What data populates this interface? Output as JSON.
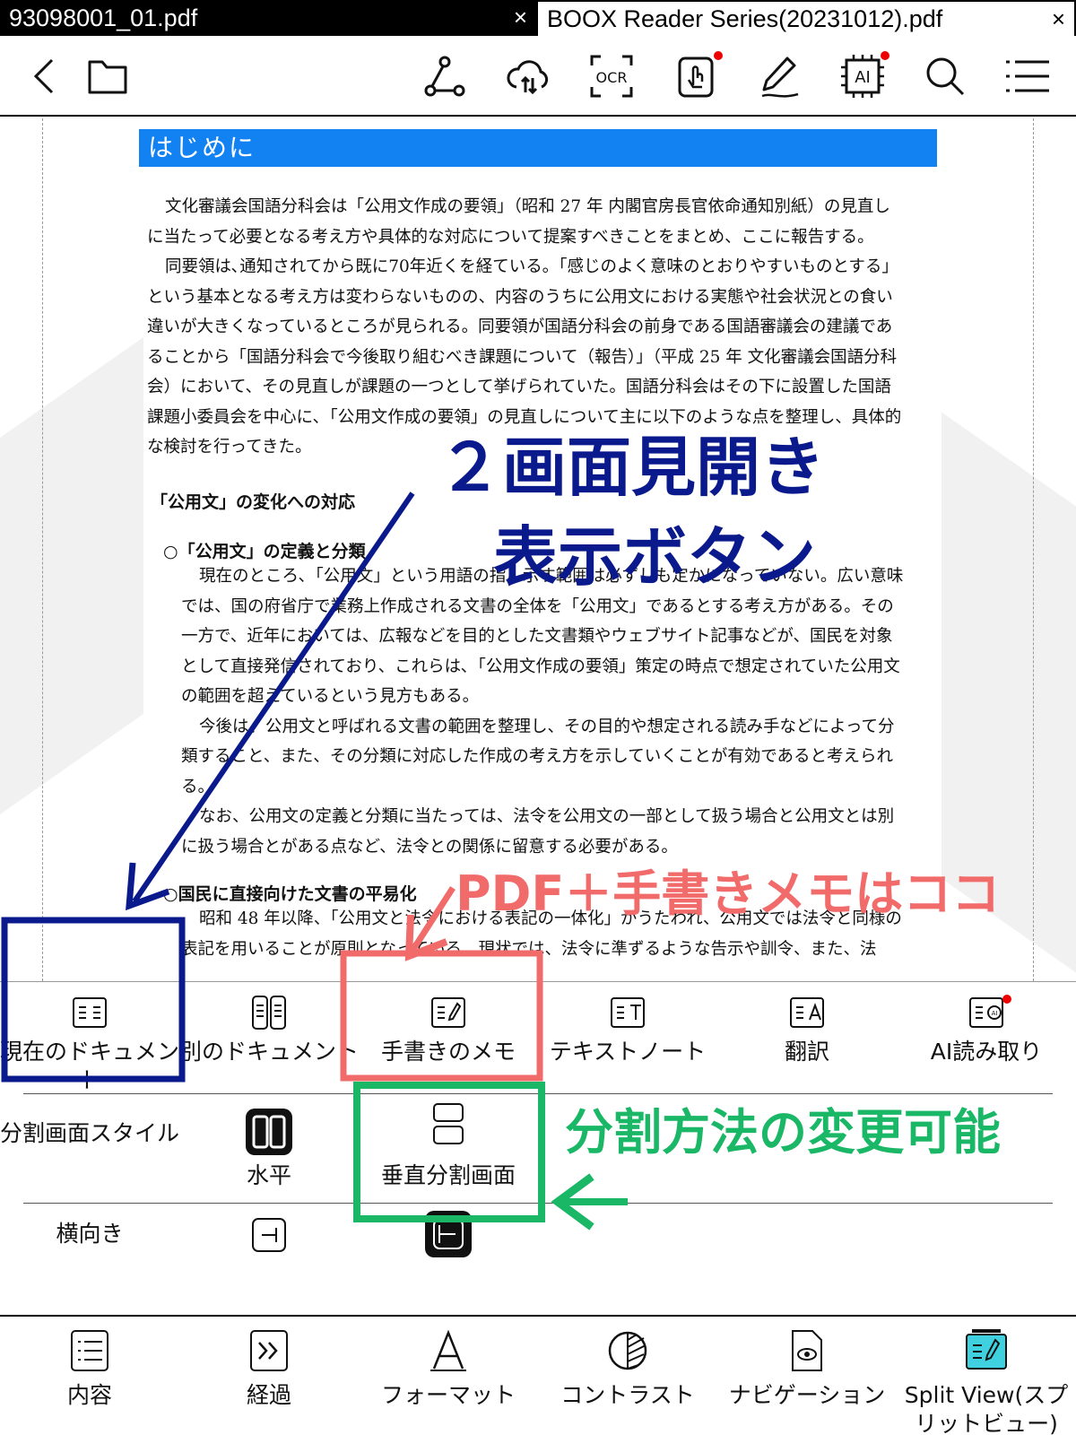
{
  "tabs": [
    {
      "label": "93098001_01.pdf",
      "close": "×"
    },
    {
      "label": "BOOX Reader Series(20231012).pdf",
      "close": "×"
    }
  ],
  "toolbar": {
    "icons": [
      "back-chevron-icon",
      "folder-icon",
      "link-icon",
      "cloud-sync-icon",
      "ocr-icon",
      "touch-hand-icon",
      "pen-icon",
      "ai-icon",
      "search-icon",
      "menu-icon"
    ],
    "ocr_text": "OCR",
    "ai_text": "AI"
  },
  "document": {
    "heading": "はじめに",
    "intro_lines": [
      "文化審議会国語分科会は「公用文作成の要領」（昭和 27 年 内閣官房長官依命通知別紙）の見直し",
      "に当たって必要となる考え方や具体的な対応について提案すべきことをまとめ、ここに報告する。",
      "同要領は､通知されてから既に70年近くを経ている｡「感じのよく意味のとおりやすいものとする」",
      "という基本となる考え方は変わらないものの、内容のうちに公用文における実態や社会状況との食い",
      "違いが大きくなっているところが見られる。同要領が国語分科会の前身である国語審議会の建議であ",
      "ることから「国語分科会で今後取り組むべき課題について（報告）」（平成 25 年 文化審議会国語分科",
      "会）において、その見直しが課題の一つとして挙げられていた。国語分科会はその下に設置した国語",
      "課題小委員会を中心に､「公用文作成の要領」の見直しについて主に以下のような点を整理し、具体的",
      "な検討を行ってきた。"
    ],
    "section_title": "「公用文」の変化への対応",
    "subsection1_title": "○「公用文」の定義と分類",
    "sub1_lines": [
      "現在のところ､「公用文」という用語の指し示す範囲は必ずしも定かになっていない。広い意味",
      "では、国の府省庁で業務上作成される文書の全体を「公用文」であるとする考え方がある。その",
      "一方で、近年においては、広報などを目的とした文書類やウェブサイト記事などが、国民を対象",
      "として直接発信されており、これらは､「公用文作成の要領」策定の時点で想定されていた公用文",
      "の範囲を超えているという見方もある。",
      "今後は、公用文と呼ばれる文書の範囲を整理し、その目的や想定される読み手などによって分",
      "類すること、また、その分類に対応した作成の考え方を示していくことが有効であると考えられ",
      "る。",
      "なお、公用文の定義と分類に当たっては、法令を公用文の一部として扱う場合と公用文とは別",
      "に扱う場合とがある点など、法令との関係に留意する必要がある。"
    ],
    "subsection2_title": "○国民に直接向けた文書の平易化",
    "sub2_lines": [
      "昭和 48 年以降、「公用文と法令における表記の一体化」がうたわれ、公用文では法令と同様の",
      "表記を用いることが原則となっている。現状では、法令に準ずるような告示や訓令、また、法"
    ]
  },
  "annotations": {
    "blue_line1": "２画面見開き",
    "blue_line2": "表示ボタン",
    "red_text": "PDF＋手書きメモはココ",
    "green_text": "分割方法の変更可能",
    "colors": {
      "blue": "#0a1a8c",
      "red": "#f26b6b",
      "green": "#19b766"
    }
  },
  "split_panel": {
    "doc_tabs": [
      {
        "label": "現在のドキュメント",
        "icon": "document-lines-icon"
      },
      {
        "label": "別のドキュメント",
        "icon": "dual-document-icon"
      },
      {
        "label": "手書きのメモ",
        "icon": "handwriting-note-icon"
      },
      {
        "label": "テキストノート",
        "icon": "text-note-icon"
      },
      {
        "label": "翻訳",
        "icon": "translate-icon"
      },
      {
        "label": "AI読み取り",
        "icon": "ai-read-icon"
      }
    ],
    "style_label": "分割画面スタイル",
    "style_options": [
      {
        "label": "水平",
        "icon": "horizontal-split-icon",
        "selected": true
      },
      {
        "label": "垂直分割画面",
        "icon": "vertical-split-icon",
        "selected": false
      }
    ],
    "orientation_label": "横向き",
    "orientation_icons": [
      "landscape-left-icon",
      "landscape-right-icon"
    ]
  },
  "bottom_menu": [
    {
      "label": "内容",
      "icon": "contents-icon"
    },
    {
      "label": "経過",
      "icon": "progress-icon"
    },
    {
      "label": "フォーマット",
      "icon": "format-icon"
    },
    {
      "label": "コントラスト",
      "icon": "contrast-icon"
    },
    {
      "label": "ナビゲーション",
      "icon": "navigation-icon"
    },
    {
      "label": "Split View(スプリットビュー)",
      "icon": "split-view-icon"
    }
  ]
}
